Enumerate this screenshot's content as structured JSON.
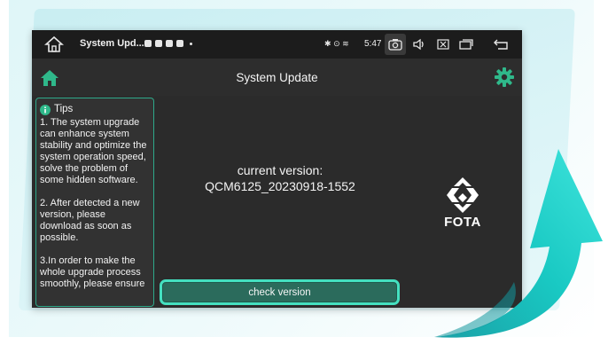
{
  "status_bar": {
    "app_title": "System Upd...",
    "time": "5:47",
    "notification_icons": [
      "chat-icon",
      "gallery-icon",
      "youtube-icon",
      "app-icon",
      "dot-icon"
    ],
    "status_icons": [
      "bluetooth-icon",
      "location-icon",
      "wifi-icon"
    ],
    "system_buttons": [
      "home-icon",
      "camera-icon",
      "volume-icon",
      "close-icon",
      "recent-apps-icon",
      "back-icon"
    ]
  },
  "app_bar": {
    "title": "System Update",
    "left_icon": "home-icon",
    "right_icon": "gear-icon"
  },
  "tips": {
    "heading": "Tips",
    "items": [
      "1. The system upgrade can enhance system stability and optimize the system operation speed, solve the problem of some hidden software.",
      "2. After detected a new version, please download as soon as possible.",
      "3.In order to make the whole upgrade process smoothly, please ensure"
    ]
  },
  "version": {
    "label": "current version:",
    "value": "QCM6125_20230918-1552"
  },
  "fota": {
    "label": "FOTA"
  },
  "actions": {
    "check_version_label": "check version"
  },
  "colors": {
    "accent": "#2fb88a",
    "button_border": "#44e0c0",
    "button_fill": "#2b6b5c",
    "screen_bg": "#2b2b2b",
    "arrow_gradient_start": "#0fd3c8",
    "arrow_gradient_end": "#1aa0a6"
  }
}
